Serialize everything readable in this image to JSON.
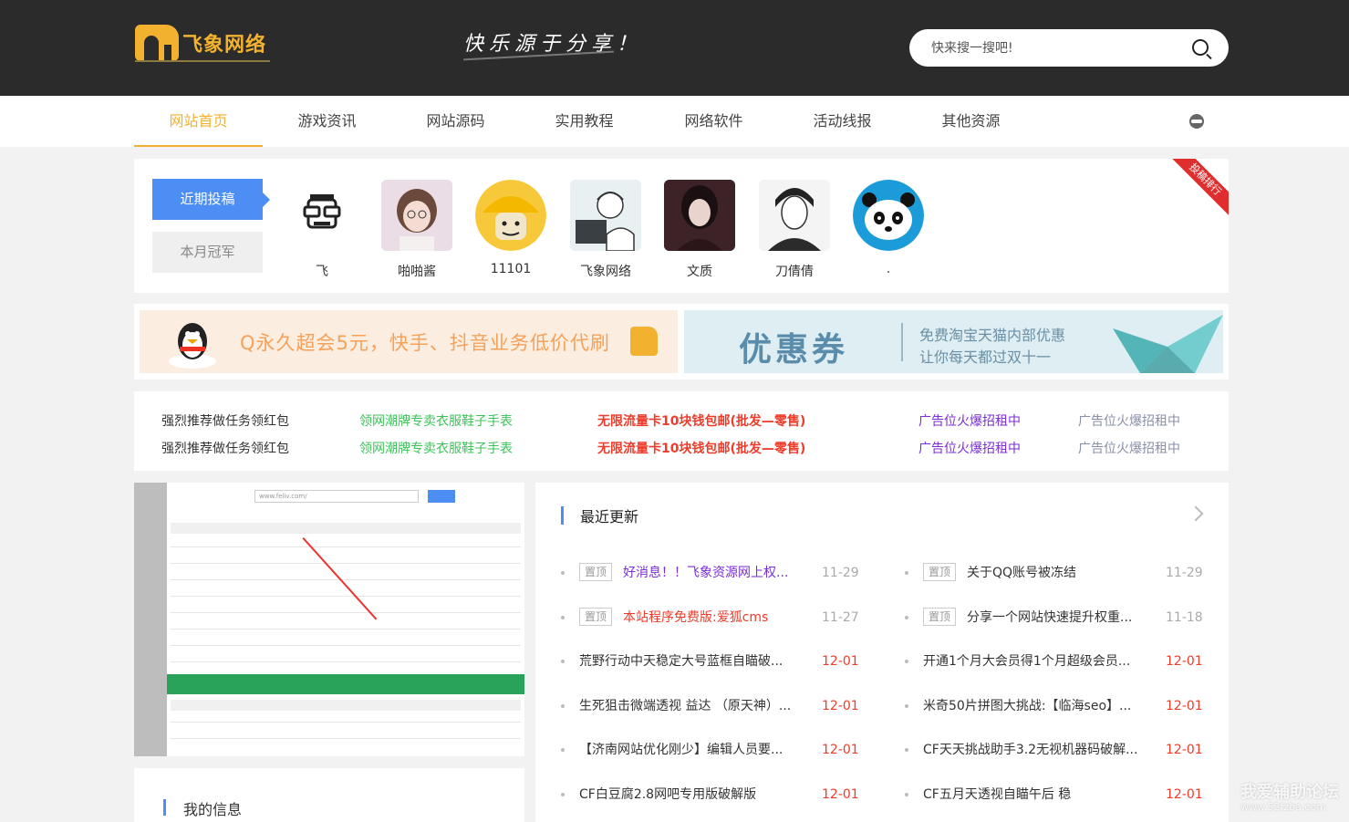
{
  "header": {
    "logo_text": "飞象网络",
    "slogan": "快乐源于分享！",
    "search_placeholder": "快来搜一搜吧!"
  },
  "nav": {
    "items": [
      {
        "label": "网站首页",
        "active": true
      },
      {
        "label": "游戏资讯"
      },
      {
        "label": "网站源码"
      },
      {
        "label": "实用教程"
      },
      {
        "label": "网络软件"
      },
      {
        "label": "活动线报"
      },
      {
        "label": "其他资源"
      }
    ]
  },
  "posters": {
    "tab_recent": "近期投稿",
    "tab_champion": "本月冠军",
    "ribbon": "投稿排行",
    "users": [
      {
        "name": "飞",
        "avatar": "robot-avatar"
      },
      {
        "name": "啪啪酱",
        "avatar": "girl-photo-avatar"
      },
      {
        "name": "11101",
        "avatar": "yellow-helmet-avatar"
      },
      {
        "name": "飞象网络",
        "avatar": "sketch-avatar"
      },
      {
        "name": "文质",
        "avatar": "dark-portrait-avatar"
      },
      {
        "name": "刀倩倩",
        "avatar": "sketch-boy-avatar"
      },
      {
        "name": ".",
        "avatar": "panda-avatar"
      }
    ]
  },
  "banners": {
    "left_text": "Q永久超会5元，快手、抖音业务低价代刷",
    "right_big": "优惠券",
    "right_line1": "免费淘宝天猫内部优惠",
    "right_line2": "让你每天都过双十一"
  },
  "ads": {
    "rows": [
      [
        "强烈推荐做任务领红包",
        "领网潮牌专卖衣服鞋子手表",
        "无限流量卡10块钱包邮(批发—零售)",
        "广告位火爆招租中",
        "广告位火爆招租中"
      ],
      [
        "强烈推荐做任务领红包",
        "领网潮牌专卖衣服鞋子手表",
        "无限流量卡10块钱包邮(批发—零售)",
        "广告位火爆招租中",
        "广告位火爆招租中"
      ]
    ],
    "colors": [
      "#333333",
      "#3cc35a",
      "#ee3b2a",
      "#7b2ed9",
      "#8a8fa8"
    ]
  },
  "shot": {
    "url": "www.feliv.com/"
  },
  "my_info": {
    "title": "我的信息"
  },
  "news": {
    "title": "最近更新",
    "tag_label": "置顶",
    "left": [
      {
        "title": "好消息！！飞象资源网上权...",
        "date": "11-29",
        "pinned": true,
        "color": "#7b2ed9"
      },
      {
        "title": "本站程序免费版:爱狐cms",
        "date": "11-27",
        "pinned": true,
        "color": "#ee3b2a"
      },
      {
        "title": "荒野行动中天稳定大号蓝框自瞄破...",
        "date": "12-01",
        "pinned": false,
        "color": "#333333"
      },
      {
        "title": "生死狙击微端透视 益达 （原天神）...",
        "date": "12-01",
        "pinned": false,
        "color": "#333333"
      },
      {
        "title": "【济南网站优化刚少】编辑人员要...",
        "date": "12-01",
        "pinned": false,
        "color": "#333333"
      },
      {
        "title": "CF白豆腐2.8网吧专用版破解版",
        "date": "12-01",
        "pinned": false,
        "color": "#333333"
      }
    ],
    "right": [
      {
        "title": "关于QQ账号被冻结",
        "date": "11-29",
        "pinned": true,
        "color": "#333333"
      },
      {
        "title": "分享一个网站快速提升权重...",
        "date": "11-18",
        "pinned": true,
        "color": "#333333"
      },
      {
        "title": "开通1个月大会员得1个月超级会员...",
        "date": "12-01",
        "pinned": false,
        "color": "#333333"
      },
      {
        "title": "米奇50片拼图大挑战:【临海seo】...",
        "date": "12-01",
        "pinned": false,
        "color": "#333333"
      },
      {
        "title": "CF天天挑战助手3.2无视机器码破解...",
        "date": "12-01",
        "pinned": false,
        "color": "#333333"
      },
      {
        "title": "CF五月天透视自瞄午后 稳",
        "date": "12-01",
        "pinned": false,
        "color": "#333333"
      }
    ]
  },
  "watermark": {
    "line1": "我爱辅助论坛",
    "line2": "www.52fzba.com"
  }
}
